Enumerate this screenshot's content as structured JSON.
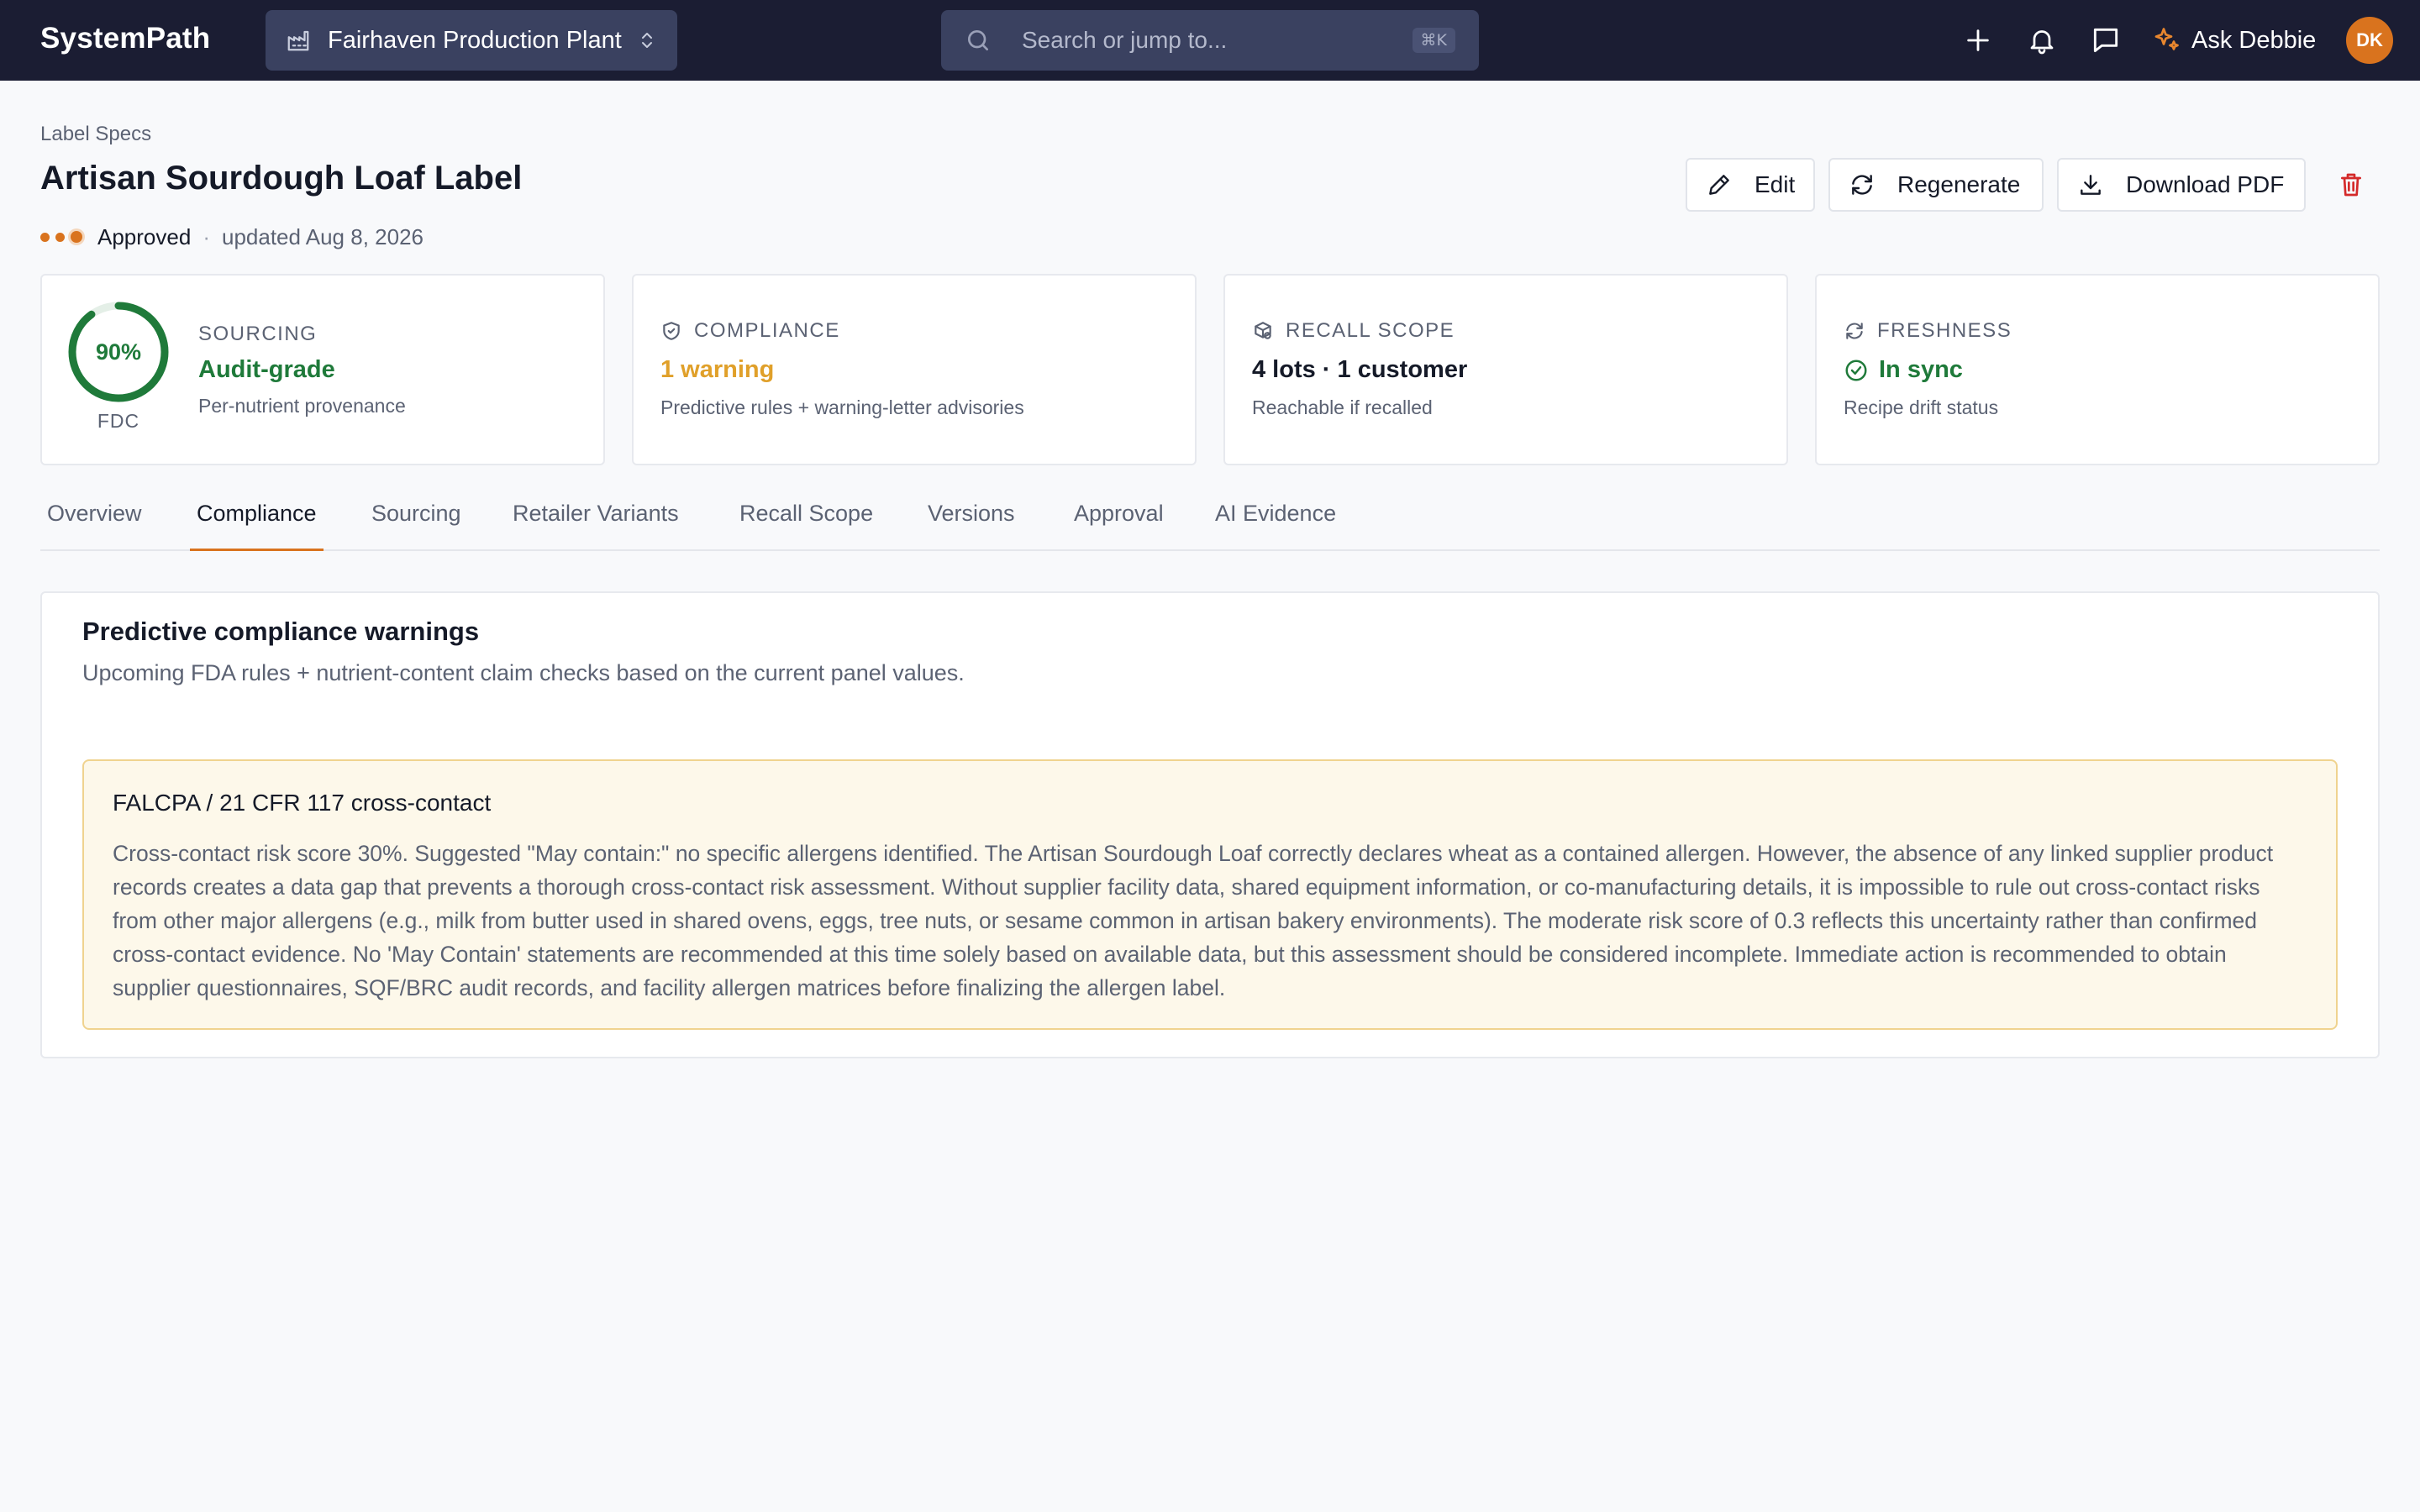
{
  "app": {
    "logo": "SystemPath",
    "plant": "Fairhaven Production Plant",
    "search_placeholder": "Search or jump to...",
    "search_shortcut": "⌘K",
    "ask_label": "Ask Debbie",
    "avatar_initials": "DK",
    "accent_color": "#d9731e"
  },
  "header": {
    "breadcrumb": "Label Specs",
    "title": "Artisan Sourdough Loaf Label",
    "status": "Approved",
    "separator": "·",
    "updated": "updated Aug 8, 2026",
    "actions": {
      "edit": "Edit",
      "regenerate": "Regenerate",
      "download": "Download PDF"
    }
  },
  "cards": {
    "sourcing": {
      "progress_percent": 90,
      "progress_label": "90%",
      "caption": "FDC",
      "label": "SOURCING",
      "value": "Audit-grade",
      "sub": "Per-nutrient provenance",
      "color": "#1f7a3a"
    },
    "compliance": {
      "label": "COMPLIANCE",
      "value": "1 warning",
      "sub": "Predictive rules + warning-letter advisories",
      "color": "#e0a02a"
    },
    "recall": {
      "label": "RECALL SCOPE",
      "value": "4 lots · 1 customer",
      "sub": "Reachable if recalled"
    },
    "freshness": {
      "label": "FRESHNESS",
      "value": "In sync",
      "sub": "Recipe drift status",
      "color": "#1f7a3a"
    }
  },
  "tabs": [
    {
      "label": "Overview"
    },
    {
      "label": "Compliance",
      "active": true
    },
    {
      "label": "Sourcing"
    },
    {
      "label": "Retailer Variants"
    },
    {
      "label": "Recall Scope"
    },
    {
      "label": "Versions"
    },
    {
      "label": "Approval"
    },
    {
      "label": "AI Evidence"
    }
  ],
  "panel": {
    "title": "Predictive compliance warnings",
    "subtitle": "Upcoming FDA rules + nutrient-content claim checks based on the current panel values.",
    "warning": {
      "title": "FALCPA / 21 CFR 117 cross-contact",
      "body": "Cross-contact risk score 30%. Suggested \"May contain:\" no specific allergens identified. The Artisan Sourdough Loaf correctly declares wheat as a contained allergen. However, the absence of any linked supplier product records creates a data gap that prevents a thorough cross-contact risk assessment. Without supplier facility data, shared equipment information, or co-manufacturing details, it is impossible to rule out cross-contact risks from other major allergens (e.g., milk from butter used in shared ovens, eggs, tree nuts, or sesame common in artisan bakery environments). The moderate risk score of 0.3 reflects this uncertainty rather than confirmed cross-contact evidence. No 'May Contain' statements are recommended at this time solely based on available data, but this assessment should be considered incomplete. Immediate action is recommended to obtain supplier questionnaires, SQF/BRC audit records, and facility allergen matrices before finalizing the allergen label."
    }
  }
}
